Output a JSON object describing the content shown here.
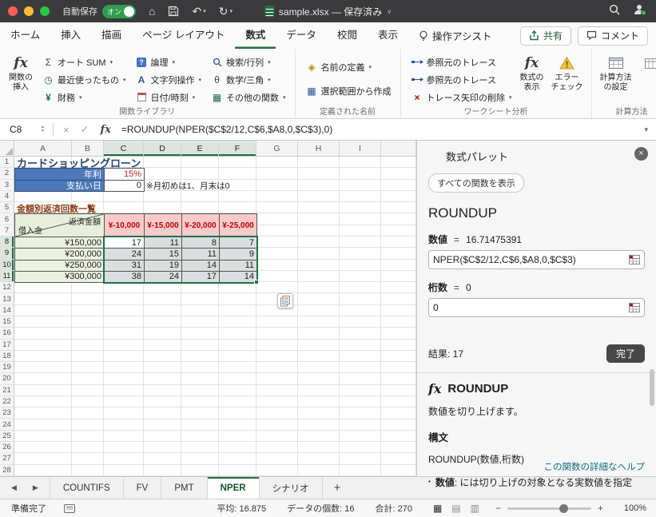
{
  "titlebar": {
    "autosave_label": "自動保存",
    "autosave_state": "オン",
    "filename": "sample.xlsx — 保存済み"
  },
  "icons": {
    "home": "⌂",
    "undo": "↶",
    "redo": "↻",
    "caret": "▾",
    "up": "▴",
    "chevdown": "∨",
    "left": "◀",
    "right": "▶",
    "close": "×",
    "bullet": "▪",
    "sigma": "Σ",
    "clock": "◷",
    "yen": "¥",
    "question": "?",
    "letterA": "A",
    "theta": "θ",
    "grid": "▦",
    "diamond": "◈",
    "cross": "×",
    "minus": "−",
    "plus": "+",
    "viewNormal": "▦",
    "viewLayout": "▤",
    "viewBreak": "▥"
  },
  "ribbon": {
    "tabs": {
      "home": "ホーム",
      "insert": "挿入",
      "draw": "描画",
      "layout": "ページ レイアウト",
      "formulas": "数式",
      "data": "データ",
      "review": "校閲",
      "view": "表示",
      "assist": "操作アシスト"
    },
    "share_label": "共有",
    "comments_label": "コメント",
    "insert_fn": {
      "icon": "fx",
      "line1": "関数の",
      "line2": "挿入"
    },
    "library": {
      "group_label": "関数ライブラリ",
      "autosum": "オート SUM",
      "recent": "最近使ったもの",
      "financial": "財務",
      "logical": "論理",
      "text": "文字列操作",
      "datetime": "日付/時刻",
      "lookup": "検索/行列",
      "math": "数学/三角",
      "more": "その他の関数"
    },
    "names": {
      "group_label": "定義された名前",
      "define": "名前の定義",
      "create": "選択範囲から作成"
    },
    "audit": {
      "group_label": "ワークシート分析",
      "precedents": "参照元のトレース",
      "dependents": "参照先のトレース",
      "remove_arrows": "トレース矢印の削除",
      "show_formulas": {
        "line1": "数式の",
        "line2": "表示"
      },
      "error_check": {
        "line1": "エラー",
        "line2": "チェック"
      }
    },
    "calc": {
      "group_label": "計算方法",
      "settings": {
        "line1": "計算方法",
        "line2": "の設定"
      }
    }
  },
  "formula_bar": {
    "cell_ref": "C8",
    "cancel_icon": "×",
    "enter_icon": "✓",
    "fx_label": "fx",
    "formula": "=ROUNDUP(NPER($C$2/12,C$6,$A8,0,$C$3),0)"
  },
  "sheet": {
    "columns": [
      "A",
      "B",
      "C",
      "D",
      "E",
      "F",
      "G",
      "H",
      "I",
      ""
    ],
    "row_count": 28,
    "sel_cols": [
      2,
      3,
      4,
      5
    ],
    "sel_rows": [
      8,
      9,
      10,
      11
    ],
    "sel_rect": {
      "r1": 8,
      "r2": 11,
      "c1": 2,
      "c2": 5
    },
    "cells": [
      {
        "r": 1,
        "c": 0,
        "cs": 4,
        "cls": "sheet-title",
        "text": "カードショッピングローン"
      },
      {
        "r": 2,
        "c": 0,
        "cs": 2,
        "cls": "blue-hdr",
        "text": "年利"
      },
      {
        "r": 2,
        "c": 2,
        "cls": "val red",
        "text": "15%"
      },
      {
        "r": 3,
        "c": 0,
        "cs": 2,
        "cls": "blue-hdr",
        "text": "支払い日"
      },
      {
        "r": 3,
        "c": 2,
        "cls": "val",
        "text": "0"
      },
      {
        "r": 3,
        "c": 3,
        "cs": 5,
        "cls": "note",
        "text": "※月初めは1、月末は0"
      },
      {
        "r": 5,
        "c": 0,
        "cs": 4,
        "cls": "section-title",
        "text": "金額別返済回数一覧"
      },
      {
        "r": 6,
        "c": 0,
        "cs": 2,
        "rs": 2,
        "cls": "diag",
        "text": "返済金額|借入金"
      },
      {
        "r": 6,
        "c": 2,
        "rs": 2,
        "cls": "pink-hdr",
        "text": "¥-10,000"
      },
      {
        "r": 6,
        "c": 3,
        "rs": 2,
        "cls": "pink-hdr",
        "text": "¥-15,000"
      },
      {
        "r": 6,
        "c": 4,
        "rs": 2,
        "cls": "pink-hdr",
        "text": "¥-20,000"
      },
      {
        "r": 6,
        "c": 5,
        "rs": 2,
        "cls": "pink-hdr",
        "text": "¥-25,000"
      },
      {
        "r": 8,
        "c": 0,
        "cs": 2,
        "cls": "green-lbl",
        "text": "¥150,000"
      },
      {
        "r": 8,
        "c": 2,
        "cls": "data active",
        "text": "17"
      },
      {
        "r": 8,
        "c": 3,
        "cls": "data tint",
        "text": "11"
      },
      {
        "r": 8,
        "c": 4,
        "cls": "data tint",
        "text": "8"
      },
      {
        "r": 8,
        "c": 5,
        "cls": "data tint",
        "text": "7"
      },
      {
        "r": 9,
        "c": 0,
        "cs": 2,
        "cls": "green-lbl",
        "text": "¥200,000"
      },
      {
        "r": 9,
        "c": 2,
        "cls": "data tint",
        "text": "24"
      },
      {
        "r": 9,
        "c": 3,
        "cls": "data tint",
        "text": "15"
      },
      {
        "r": 9,
        "c": 4,
        "cls": "data tint",
        "text": "11"
      },
      {
        "r": 9,
        "c": 5,
        "cls": "data tint",
        "text": "9"
      },
      {
        "r": 10,
        "c": 0,
        "cs": 2,
        "cls": "green-lbl",
        "text": "¥250,000"
      },
      {
        "r": 10,
        "c": 2,
        "cls": "data tint",
        "text": "31"
      },
      {
        "r": 10,
        "c": 3,
        "cls": "data tint",
        "text": "19"
      },
      {
        "r": 10,
        "c": 4,
        "cls": "data tint",
        "text": "14"
      },
      {
        "r": 10,
        "c": 5,
        "cls": "data tint",
        "text": "11"
      },
      {
        "r": 11,
        "c": 0,
        "cs": 2,
        "cls": "green-lbl",
        "text": "¥300,000"
      },
      {
        "r": 11,
        "c": 2,
        "cls": "data tint",
        "text": "38"
      },
      {
        "r": 11,
        "c": 3,
        "cls": "data tint",
        "text": "24"
      },
      {
        "r": 11,
        "c": 4,
        "cls": "data tint",
        "text": "17"
      },
      {
        "r": 11,
        "c": 5,
        "cls": "data tint",
        "text": "14"
      }
    ]
  },
  "pane": {
    "title": "数式パレット",
    "show_all_label": "すべての関数を表示",
    "function_name": "ROUNDUP",
    "arg1_name": "数値",
    "arg1_eq": "=",
    "arg1_value": "16.71475391",
    "arg1_input": "NPER($C$2/12,C$6,$A8,0,$C$3)",
    "arg2_name": "桁数",
    "arg2_eq": "=",
    "arg2_value": "0",
    "arg2_input": "0",
    "result_label": "結果: 17",
    "done_label": "完了",
    "help_fx": "fx",
    "help_name": "ROUNDUP",
    "help_desc": "数値を切り上げます。",
    "syntax_label": "構文",
    "syntax_text": "ROUNDUP(数値,桁数)",
    "bullet_term": "数値",
    "bullet_rest": ": には切り上げの対象となる実数値を指定",
    "more_help_label": "この関数の詳細なヘルプ"
  },
  "tabs_bar": {
    "sheets": [
      "COUNTIFS",
      "FV",
      "PMT",
      "NPER",
      "シナリオ"
    ],
    "active": "NPER",
    "add": "+"
  },
  "status_bar": {
    "ready": "準備完了",
    "average": "平均: 16.875",
    "count": "データの個数: 16",
    "sum": "合計: 270",
    "zoom": "100%"
  }
}
